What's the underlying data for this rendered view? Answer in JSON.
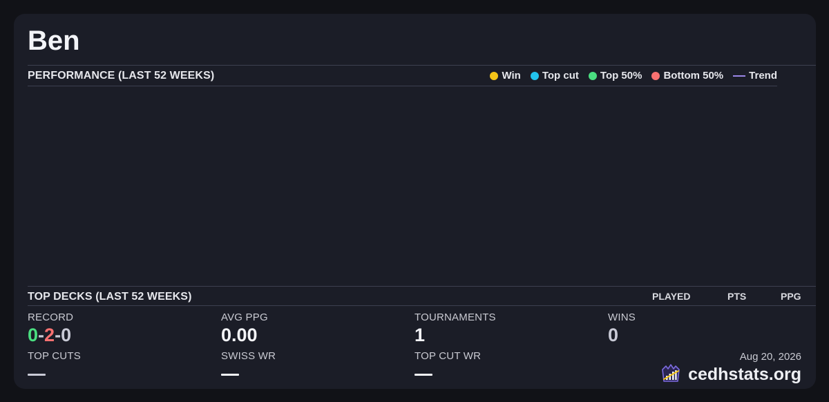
{
  "player": {
    "name": "Ben"
  },
  "performance": {
    "title": "PERFORMANCE (LAST 52 WEEKS)",
    "legend": [
      {
        "label": "Win",
        "color": "#f5c518",
        "kind": "dot"
      },
      {
        "label": "Top cut",
        "color": "#22c3ee",
        "kind": "dot"
      },
      {
        "label": "Top 50%",
        "color": "#4ade80",
        "kind": "dot"
      },
      {
        "label": "Bottom 50%",
        "color": "#f87171",
        "kind": "dot"
      },
      {
        "label": "Trend",
        "color": "#9b86e8",
        "kind": "line"
      }
    ]
  },
  "chart_data": {
    "type": "scatter",
    "title": "PERFORMANCE (LAST 52 WEEKS)",
    "series": [
      {
        "name": "Win",
        "values": []
      },
      {
        "name": "Top cut",
        "values": []
      },
      {
        "name": "Top 50%",
        "values": []
      },
      {
        "name": "Bottom 50%",
        "values": []
      },
      {
        "name": "Trend",
        "values": []
      }
    ],
    "legend": "top-right"
  },
  "top_decks": {
    "title": "TOP DECKS (LAST 52 WEEKS)",
    "columns": [
      "PLAYED",
      "PTS",
      "PPG"
    ]
  },
  "stats": {
    "record": {
      "label": "RECORD",
      "wins": "0",
      "losses": "2",
      "draws": "0",
      "sep": "-"
    },
    "avg_ppg": {
      "label": "AVG PPG",
      "value": "0.00"
    },
    "tournaments": {
      "label": "TOURNAMENTS",
      "value": "1"
    },
    "wins": {
      "label": "WINS",
      "value": "0"
    },
    "top_cuts": {
      "label": "TOP CUTS"
    },
    "swiss_wr": {
      "label": "SWISS WR"
    },
    "top_cut_wr": {
      "label": "TOP CUT WR"
    }
  },
  "footer": {
    "date": "Aug 20, 2026",
    "brand": "cedhstats.org",
    "logo_icon": "chart-logo-icon"
  },
  "colors": {
    "win_green": "#4ade80",
    "loss_red": "#f87171",
    "draw_gray": "#c9cad6"
  }
}
